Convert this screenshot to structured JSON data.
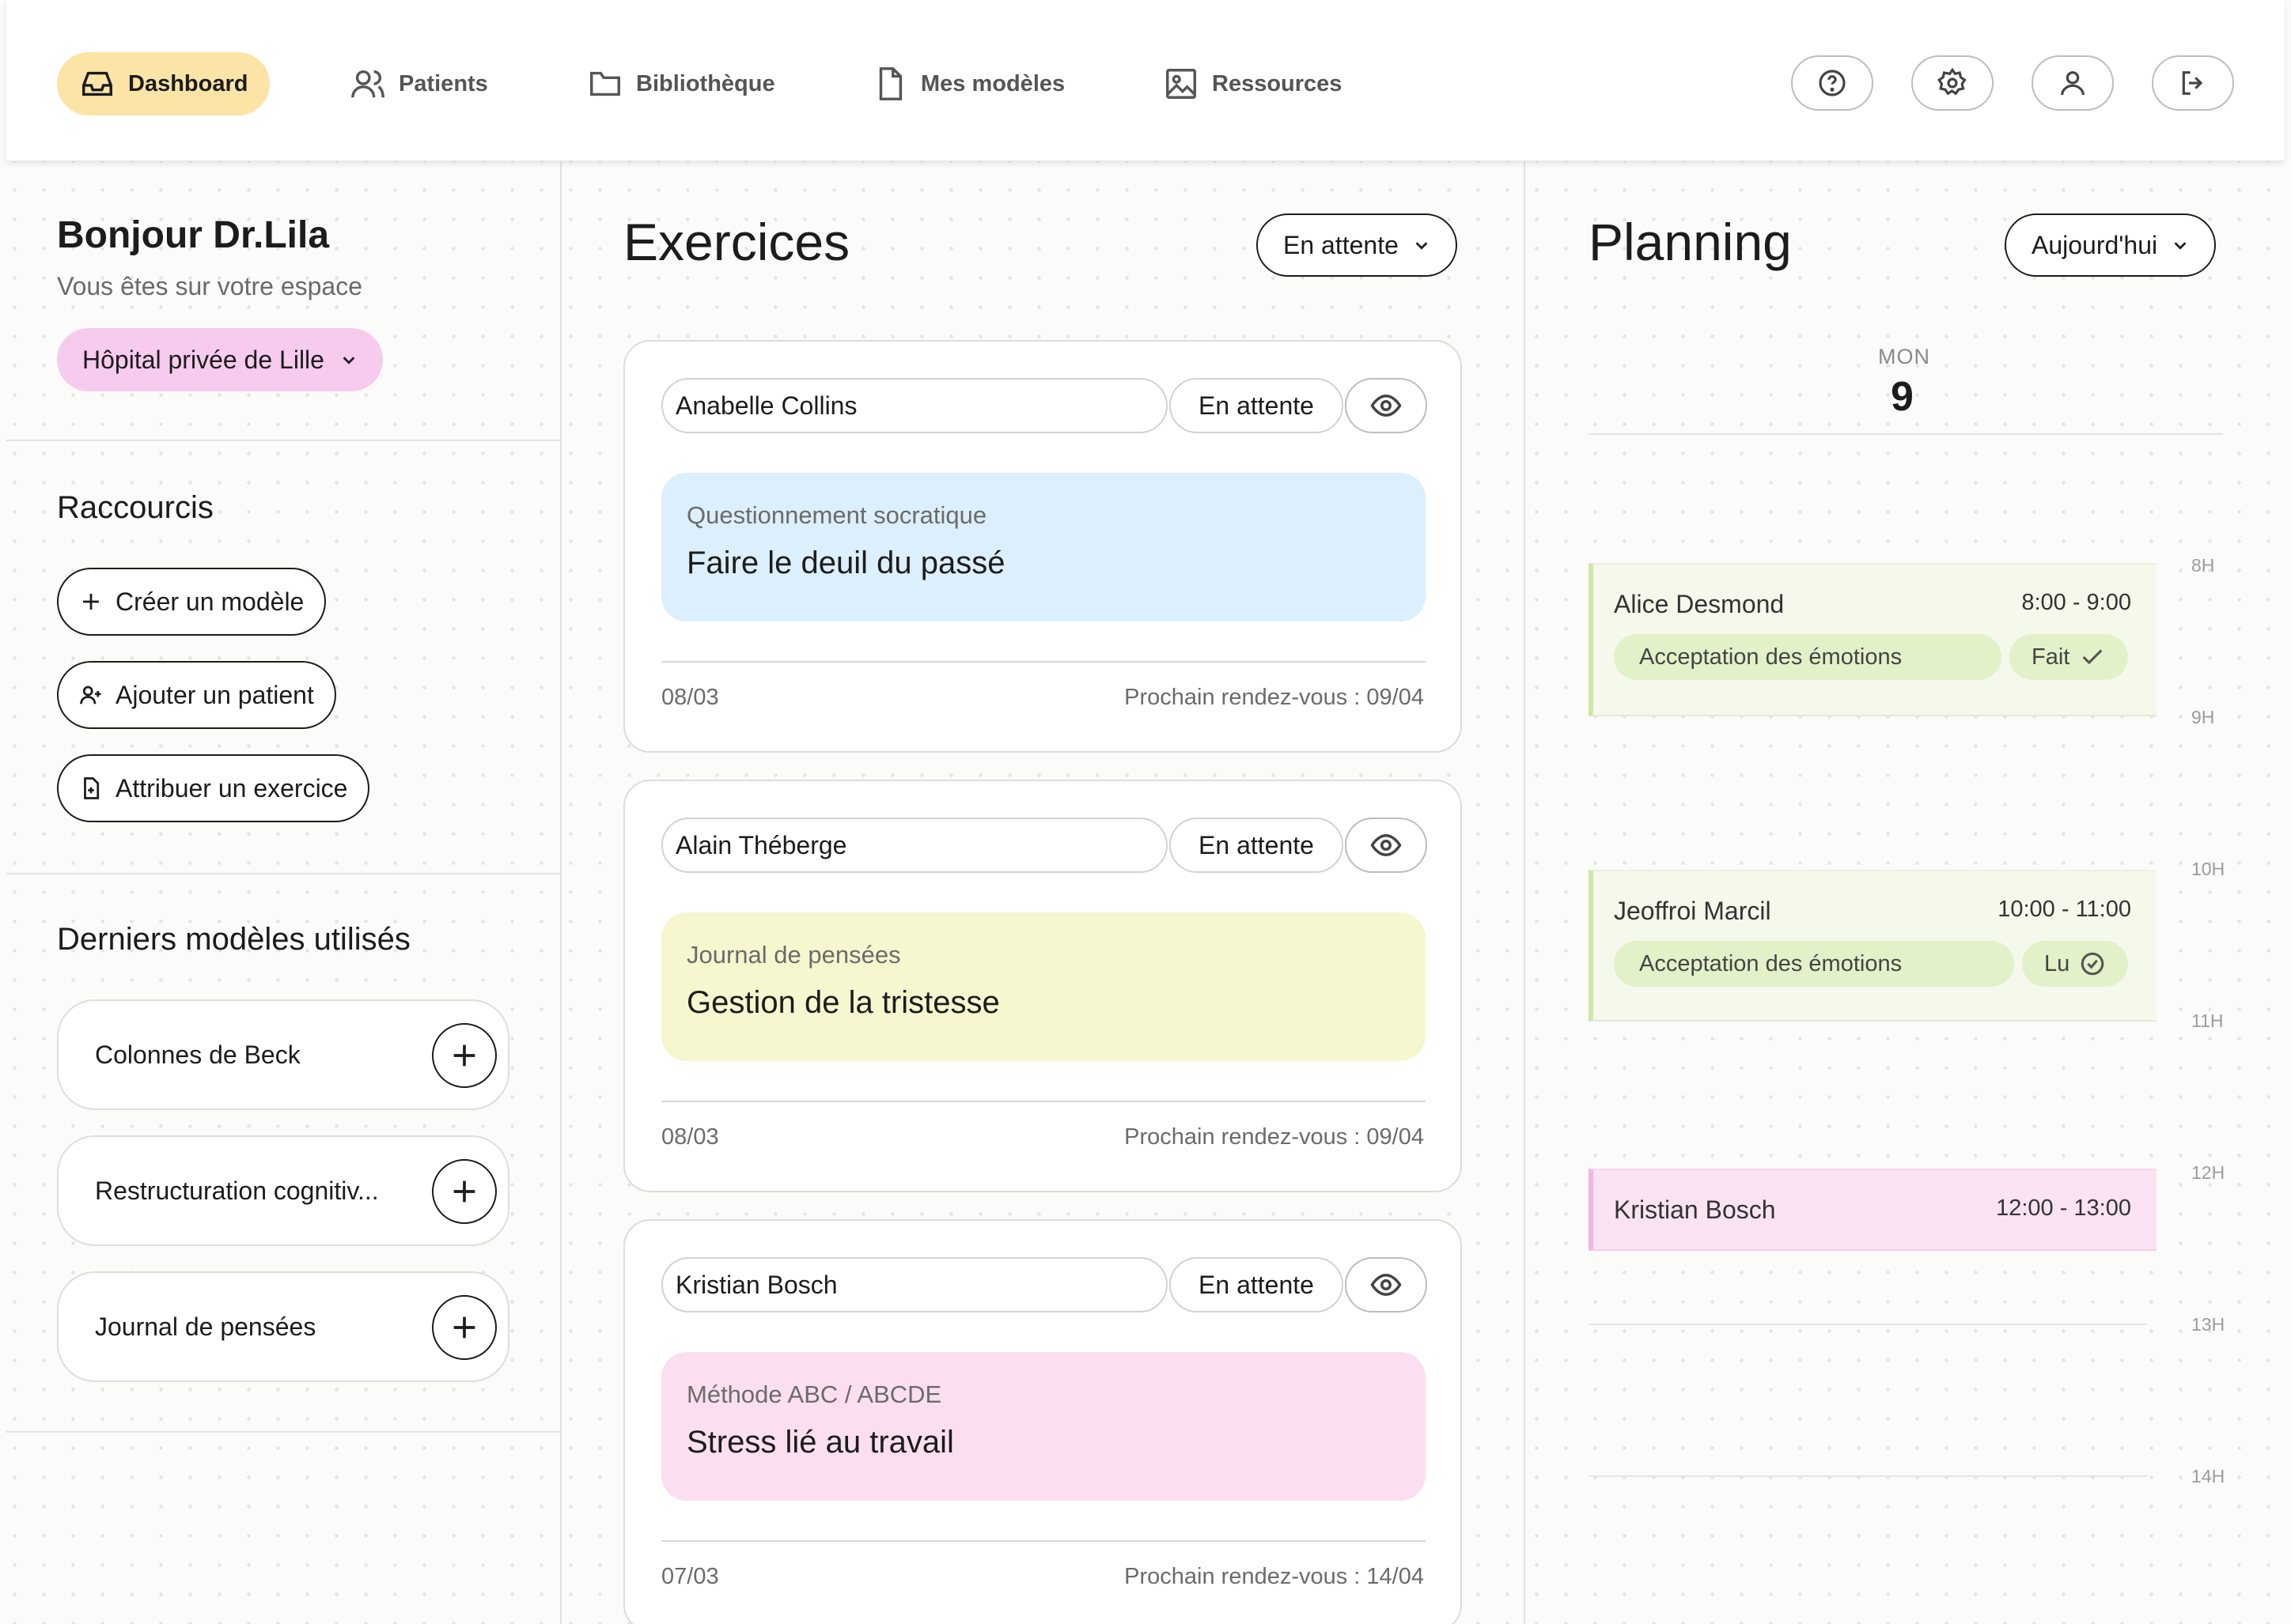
{
  "nav": {
    "items": [
      {
        "label": "Dashboard",
        "icon": "inbox-icon",
        "active": true
      },
      {
        "label": "Patients",
        "icon": "users-icon"
      },
      {
        "label": "Bibliothèque",
        "icon": "folder-icon"
      },
      {
        "label": "Mes modèles",
        "icon": "file-icon"
      },
      {
        "label": "Ressources",
        "icon": "image-icon"
      }
    ],
    "right_icons": [
      "help-icon",
      "settings-icon",
      "user-icon",
      "logout-icon"
    ]
  },
  "sidebar": {
    "greeting": "Bonjour Dr.Lila",
    "subtitle": "Vous êtes sur votre espace",
    "hospital": "Hôpital privée de Lille",
    "shortcuts_title": "Raccourcis",
    "shortcuts": [
      {
        "label": "Créer un modèle",
        "icon": "plus-icon"
      },
      {
        "label": "Ajouter un patient",
        "icon": "user-plus-icon"
      },
      {
        "label": "Attribuer un exercice",
        "icon": "file-plus-icon"
      }
    ],
    "recent_title": "Derniers modèles utilisés",
    "recent_models": [
      {
        "label": "Colonnes de Beck"
      },
      {
        "label": "Restructuration cognitiv..."
      },
      {
        "label": "Journal de pensées"
      }
    ]
  },
  "exercises": {
    "title": "Exercices",
    "filter": "En attente",
    "cards": [
      {
        "patient": "Anabelle Collins",
        "status": "En attente",
        "type": "Questionnement socratique",
        "title": "Faire le deuil du passé",
        "date": "08/03",
        "next": "Prochain rendez-vous : 09/04",
        "color": "#dbeffc"
      },
      {
        "patient": "Alain Théberge",
        "status": "En attente",
        "type": "Journal de pensées",
        "title": "Gestion de la tristesse",
        "date": "08/03",
        "next": "Prochain rendez-vous : 09/04",
        "color": "#f6f6cf"
      },
      {
        "patient": "Kristian Bosch",
        "status": "En attente",
        "type": "Méthode ABC / ABCDE",
        "title": "Stress lié au travail",
        "date": "07/03",
        "next": "Prochain rendez-vous : 14/04",
        "color": "#fbdff0"
      }
    ]
  },
  "planning": {
    "title": "Planning",
    "filter": "Aujourd'hui",
    "day_label": "MON",
    "day_number": "9",
    "hours": [
      "8H",
      "9H",
      "10H",
      "11H",
      "12H",
      "13H",
      "14H"
    ],
    "events": [
      {
        "name": "Alice Desmond",
        "time": "8:00 - 9:00",
        "tag": "Acceptation des émotions",
        "state": "Fait",
        "state_icon": "check-icon"
      },
      {
        "name": "Jeoffroi Marcil",
        "time": "10:00 - 11:00",
        "tag": "Acceptation des émotions",
        "state": "Lu",
        "state_icon": "check-circle-icon"
      },
      {
        "name": "Kristian Bosch",
        "time": "12:00 - 13:00"
      }
    ]
  }
}
